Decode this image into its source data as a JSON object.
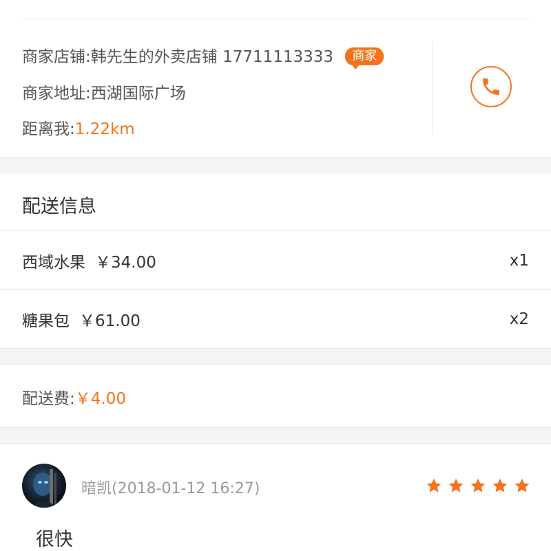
{
  "merchant": {
    "shop_label": "商家店铺:",
    "shop_name": "韩先生的外卖店铺",
    "shop_phone": "17711113333",
    "badge": "商家",
    "address_label": "商家地址:",
    "address": "西湖国际广场",
    "distance_label": "距离我:",
    "distance": "1.22km"
  },
  "delivery": {
    "title": "配送信息",
    "items": [
      {
        "name": "西域水果",
        "price": "￥34.00",
        "qty": "x1"
      },
      {
        "name": "糖果包",
        "price": "￥61.00",
        "qty": "x2"
      }
    ],
    "fee_label": "配送费:",
    "fee": "￥4.00"
  },
  "review": {
    "reviewer": "暗凯(2018-01-12 16:27)",
    "rating": 5,
    "comment": "很快"
  },
  "colors": {
    "accent": "#f5731b",
    "divider": "#e6e6e6",
    "gap": "#f4f4f4"
  },
  "icons": {
    "call": "phone-icon",
    "rating": "star-icon"
  }
}
